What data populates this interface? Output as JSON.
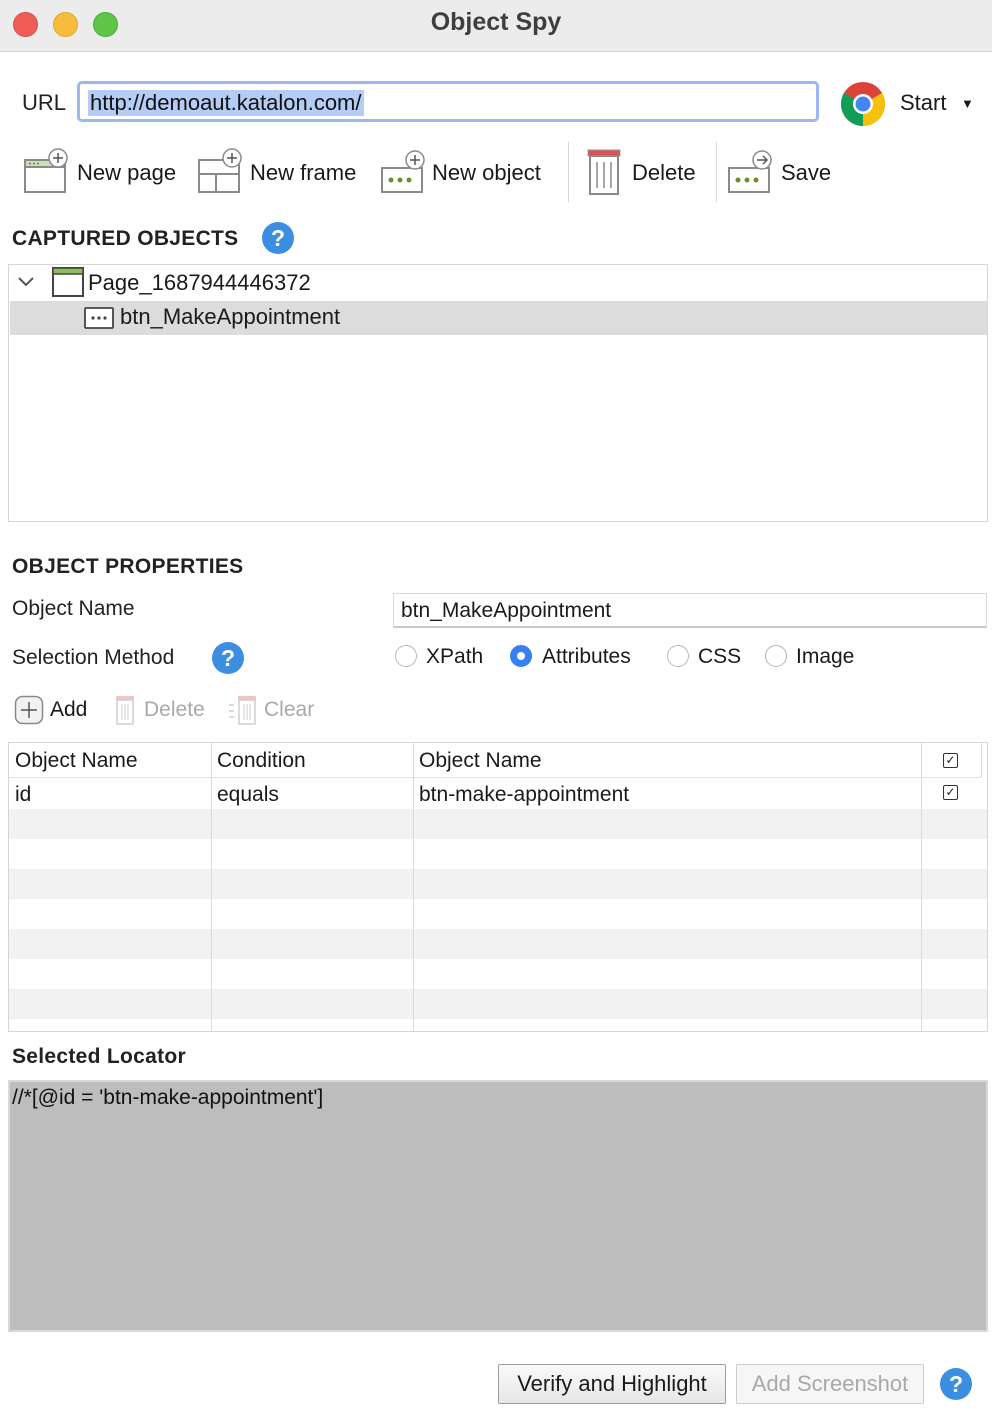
{
  "window": {
    "title": "Object Spy"
  },
  "url": {
    "label": "URL",
    "value": "http://demoaut.katalon.com/"
  },
  "browser": {
    "icon": "chrome-icon",
    "start_label": "Start"
  },
  "toolbar": {
    "new_page": "New page",
    "new_frame": "New frame",
    "new_object": "New object",
    "delete": "Delete",
    "save": "Save"
  },
  "captured": {
    "title": "CAPTURED OBJECTS",
    "page_node": "Page_1687944446372",
    "child_node": "btn_MakeAppointment"
  },
  "properties": {
    "title": "OBJECT PROPERTIES",
    "object_name_label": "Object Name",
    "object_name_value": "btn_MakeAppointment",
    "selection_method_label": "Selection Method",
    "methods": [
      "XPath",
      "Attributes",
      "CSS",
      "Image"
    ],
    "selected_method": "Attributes",
    "add": "Add",
    "delete": "Delete",
    "clear": "Clear"
  },
  "table": {
    "headers": [
      "Object Name",
      "Condition",
      "Object Name"
    ],
    "rows": [
      {
        "name": "id",
        "condition": "equals",
        "value": "btn-make-appointment",
        "checked": true
      }
    ]
  },
  "locator": {
    "title": "Selected Locator",
    "value": "//*[@id = 'btn-make-appointment']"
  },
  "footer": {
    "verify": "Verify and Highlight",
    "add_screenshot": "Add Screenshot"
  },
  "colors": {
    "accent": "#3a7ff0",
    "help": "#3c8fe0",
    "locator_bg": "#bdbdbd"
  }
}
